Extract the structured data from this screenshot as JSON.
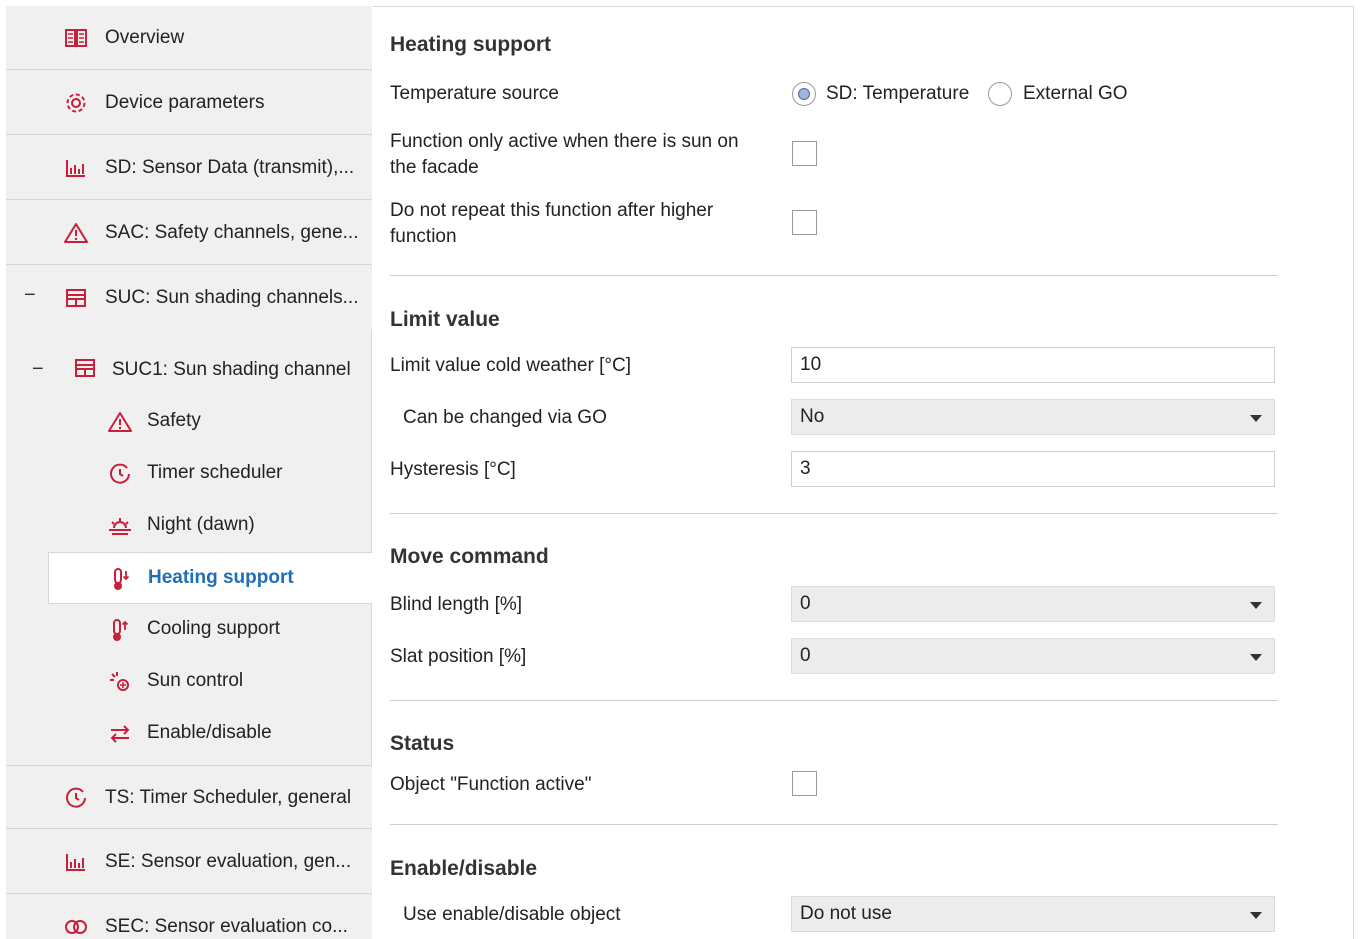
{
  "sidebar": {
    "items": [
      {
        "label": "Overview",
        "icon": "book-icon"
      },
      {
        "label": "Device parameters",
        "icon": "gear-icon"
      },
      {
        "label": "SD: Sensor Data (transmit),...",
        "icon": "chart-icon"
      },
      {
        "label": "SAC: Safety channels, gene...",
        "icon": "warning-icon"
      },
      {
        "label": "SUC: Sun shading channels...",
        "icon": "blind-icon",
        "collapse": "−"
      }
    ],
    "channel": {
      "label": "SUC1:  Sun shading channel",
      "collapse": "−"
    },
    "subitems": [
      {
        "label": "Safety",
        "icon": "warning-icon"
      },
      {
        "label": "Timer scheduler",
        "icon": "timer-icon"
      },
      {
        "label": "Night (dawn)",
        "icon": "sunset-icon"
      },
      {
        "label": "Heating support",
        "icon": "thermometer-down-icon",
        "active": true
      },
      {
        "label": "Cooling support",
        "icon": "thermometer-up-icon"
      },
      {
        "label": "Sun control",
        "icon": "sun-icon"
      },
      {
        "label": "Enable/disable",
        "icon": "arrows-icon"
      }
    ],
    "bottom_items": [
      {
        "label": "TS: Timer Scheduler, general",
        "icon": "timer-icon"
      },
      {
        "label": "SE: Sensor evaluation, gen...",
        "icon": "chart-icon"
      },
      {
        "label": "SEC: Sensor evaluation co...",
        "icon": "rings-icon"
      }
    ],
    "accent_color": "#c8203a",
    "active_color": "#1f6fb8"
  },
  "main": {
    "heating": {
      "title": "Heating support",
      "temp_source_label": "Temperature source",
      "option_sd": "SD: Temperature",
      "option_ext": "External GO",
      "sun_facade_label_1": "Function only active when there is sun on",
      "sun_facade_label_2": "the facade",
      "no_repeat_label_1": "Do not repeat this function after higher",
      "no_repeat_label_2": "function"
    },
    "limit": {
      "title": "Limit value",
      "cold_label": "Limit value cold weather [°C]",
      "cold_value": "10",
      "changeable_label": "Can be changed via GO",
      "changeable_value": "No",
      "hyst_label": "Hysteresis [°C]",
      "hyst_value": "3"
    },
    "move": {
      "title": "Move command",
      "blind_label": "Blind length [%]",
      "blind_value": "0",
      "slat_label": "Slat position [%]",
      "slat_value": "0"
    },
    "status": {
      "title": "Status",
      "object_label": "Object \"Function active\""
    },
    "enable": {
      "title": "Enable/disable",
      "use_label": "Use enable/disable object",
      "use_value": "Do not use"
    }
  }
}
